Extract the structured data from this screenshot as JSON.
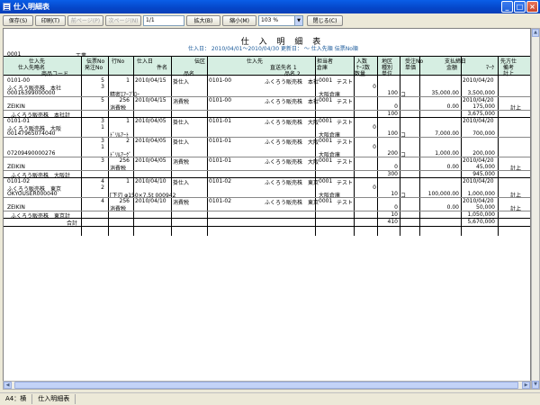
{
  "window": {
    "title": "仕入明細表"
  },
  "toolbar": {
    "save": "保存(S)",
    "print": "印刷(T)",
    "prev": "前ページ(P)",
    "next": "次ページ(N)",
    "page": "1/1",
    "zoom_in": "拡大(B)",
    "zoom_out": "縮小(M)",
    "zoom": "103 %",
    "close": "閉じる(C)"
  },
  "report": {
    "title": "仕 入 明 細 表",
    "period": "仕入日： 2010/04/01～2010/04/30 更新日： ～   仕入先順 伝票No順",
    "code": "0001",
    "koji": "工業",
    "headers": {
      "r1": [
        "仕入先",
        "伝票No",
        "行No",
        "仕入日",
        "伝区",
        "仕入先",
        "担当者",
        "入数",
        "地区",
        "受注No",
        "支払締日",
        "先方仕"
      ],
      "r2": [
        "仕入先略名",
        "発注No",
        "件名",
        "直送先名 1",
        "倉庫",
        "ｹｰｽ数",
        "種別",
        "単価",
        "金額",
        "ﾏｰｸ",
        "備考"
      ],
      "r3": [
        "商品コード",
        "品名",
        "品名 2",
        "数量",
        "単位",
        "計上"
      ]
    },
    "rows": [
      {
        "a": "0101-00",
        "b": "5",
        "c": "1",
        "d": "2010/04/15",
        "e": "掛仕入",
        "f": "0101-00",
        "g": "ふくろう販売株　本社",
        "h": "0001",
        "i": "テスト",
        "j": "",
        "k": "2010/04/20"
      },
      {
        "a": "ふくろう販売株　本社",
        "b": "3",
        "k2": "0"
      },
      {
        "a": "00016399000000",
        "b": "",
        "t": "精密ｴｱｰﾌﾞﾛｰ",
        "w": "大阪倉庫",
        "qty": "100",
        "u": "コ",
        "price": "35,000.00",
        "amt": "3,500,000"
      },
      {
        "a": "",
        "b": "5",
        "c": "256",
        "d": "2010/04/15",
        "e": "消費税",
        "f": "0101-00",
        "g": "ふくろう販売株　本社",
        "h": "0001",
        "i": "テスト",
        "k": "2010/04/20"
      },
      {
        "a": "ZEIKIN",
        "t": "消費税",
        "qty": "0",
        "price": "0.00",
        "amt": "175,000",
        "m": "計上"
      },
      {
        "sub": "ふくろう販売株　本社計",
        "qty": "100",
        "amt": "3,675,000"
      },
      {
        "a": "0101-01",
        "b": "3",
        "c": "1",
        "d": "2010/04/05",
        "e": "掛仕入",
        "f": "0101-01",
        "g": "ふくろう販売株　大阪",
        "h": "0001",
        "i": "テスト",
        "k": "2010/04/20"
      },
      {
        "a": "ふくろう販売株　大阪",
        "b": "1",
        "k2": "0"
      },
      {
        "a": "00147965074040",
        "t": "ﾄﾞﾘﾙｱｰﾄ",
        "w": "大阪倉庫",
        "qty": "100",
        "u": "コ",
        "price": "7,000.00",
        "amt": "700,000"
      },
      {
        "a": "",
        "b": "3",
        "c": "2",
        "d": "2010/04/05",
        "e": "掛仕入",
        "f": "0101-01",
        "g": "ふくろう販売株　大阪",
        "h": "0001",
        "i": "テスト"
      },
      {
        "a": "",
        "b": "1",
        "k2": "0"
      },
      {
        "a": "07209490000276",
        "t": "ﾄﾞﾘﾙｱｰｸﾞ",
        "w": "大阪倉庫",
        "qty": "200",
        "u": "コ",
        "price": "1,000.00",
        "amt": "200,000"
      },
      {
        "a": "",
        "b": "3",
        "c": "256",
        "d": "2010/04/05",
        "e": "消費税",
        "f": "0101-01",
        "g": "ふくろう販売株　大阪",
        "h": "0001",
        "i": "テスト",
        "k": "2010/04/20"
      },
      {
        "a": "ZEIKIN",
        "t": "消費税",
        "qty": "0",
        "price": "0.00",
        "amt": "45,000",
        "m": "計上"
      },
      {
        "sub": "ふくろう販売株　大阪計",
        "qty": "300",
        "amt": "945,000"
      },
      {
        "a": "0101-02",
        "b": "4",
        "c": "1",
        "d": "2010/04/10",
        "e": "掛仕入",
        "f": "0101-02",
        "g": "ふくろう販売株　東京",
        "h": "0001",
        "i": "テスト",
        "k": "2010/04/20"
      },
      {
        "a": "ふくろう販売株　東京",
        "b": "2",
        "k2": "0"
      },
      {
        "a": "OKYOUSER000040",
        "t": "[下刃 φ150×7.5t 000942",
        "w": "大阪倉庫",
        "qty": "10",
        "u": "コ",
        "price": "100,000.00",
        "amt": "1,000,000",
        "m": "計上"
      },
      {
        "a": "",
        "b": "4",
        "c": "256",
        "d": "2010/04/10",
        "e": "消費税",
        "f": "0101-02",
        "g": "ふくろう販売株　東京",
        "h": "0001",
        "i": "テスト",
        "k": "2010/04/20"
      },
      {
        "a": "ZEIKIN",
        "t": "消費税",
        "qty": "0",
        "price": "0.00",
        "amt": "50,000",
        "m": "計上"
      },
      {
        "sub": "ふくろう販売株　東京計",
        "qty": "10",
        "amt": "1,050,000"
      },
      {
        "total": "合計",
        "qty": "410",
        "amt": "5,670,000"
      }
    ]
  },
  "status": {
    "paper": "A4：横",
    "name": "仕入明細表"
  }
}
